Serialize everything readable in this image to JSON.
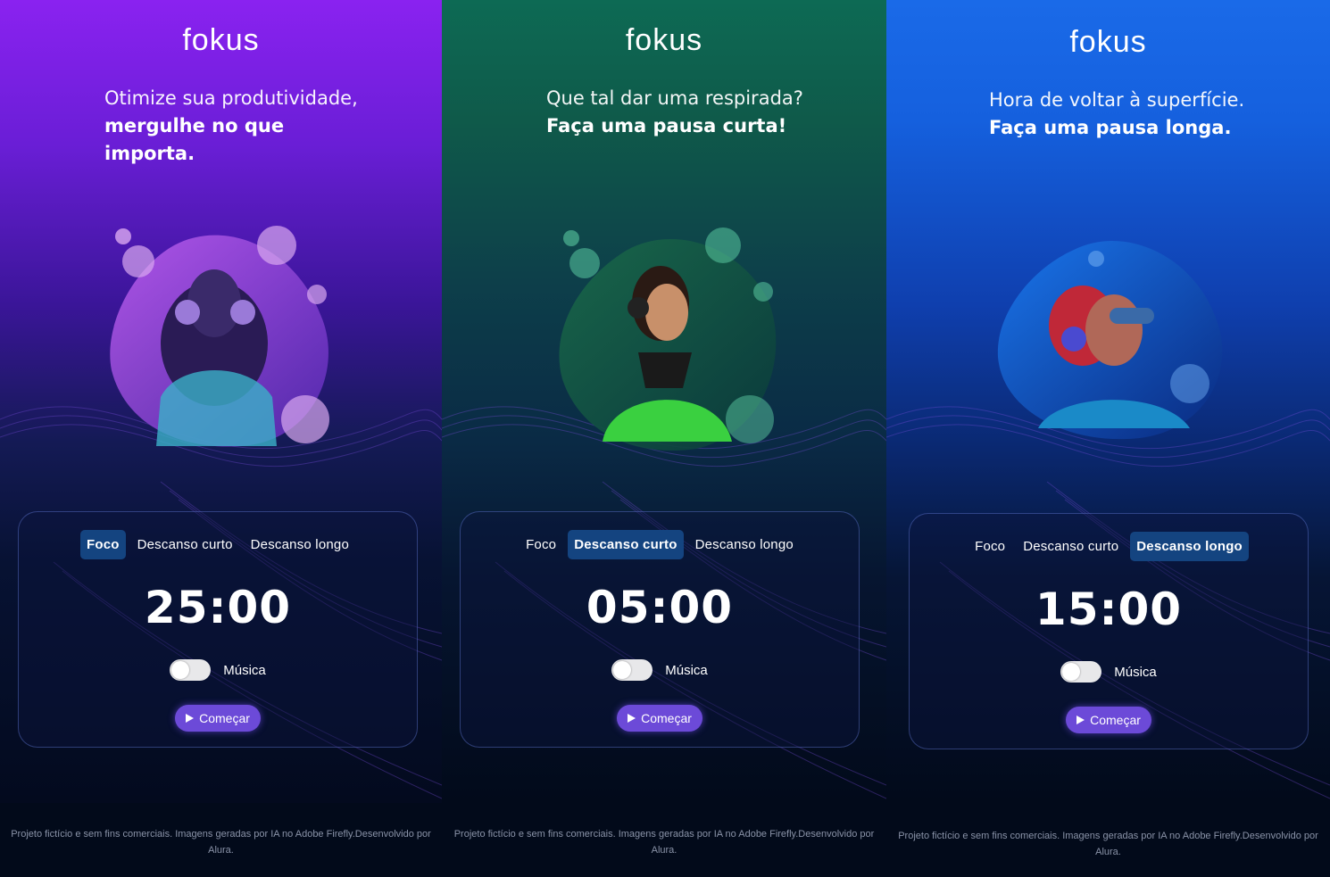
{
  "panels": [
    {
      "logo": "fokus",
      "headline_light": "Otimize sua produtividade,",
      "headline_bold": "mergulhe no que importa.",
      "tabs": [
        "Foco",
        "Descanso curto",
        "Descanso longo"
      ],
      "active_tab": "Foco",
      "timer": "25:00",
      "music_label": "Música",
      "music_on": false,
      "start_label": "Começar",
      "footer": "Projeto fictício e sem fins comerciais. Imagens geradas por IA no Adobe Firefly.Desenvolvido por Alura.",
      "accent": "#8a22f0"
    },
    {
      "logo": "fokus",
      "headline_light": "Que tal dar uma respirada?",
      "headline_bold": "Faça uma pausa curta!",
      "tabs": [
        "Foco",
        "Descanso curto",
        "Descanso longo"
      ],
      "active_tab": "Descanso curto",
      "timer": "05:00",
      "music_label": "Música",
      "music_on": false,
      "start_label": "Começar",
      "footer": "Projeto fictício e sem fins comerciais. Imagens geradas por IA no Adobe Firefly.Desenvolvido por Alura.",
      "accent": "#0d6a54"
    },
    {
      "logo": "fokus",
      "headline_light": "Hora de voltar à superfície.",
      "headline_bold": "Faça uma pausa longa.",
      "tabs": [
        "Foco",
        "Descanso curto",
        "Descanso longo"
      ],
      "active_tab": "Descanso longo",
      "timer": "15:00",
      "music_label": "Música",
      "music_on": false,
      "start_label": "Começar",
      "footer": "Projeto fictício e sem fins comerciais. Imagens geradas por IA no Adobe Firefly.Desenvolvido por Alura.",
      "accent": "#1a6ae8"
    }
  ],
  "icons": [
    "play-icon"
  ],
  "colors": {
    "active_tab_bg": "#144480",
    "start_button": "#6c4ad8"
  }
}
